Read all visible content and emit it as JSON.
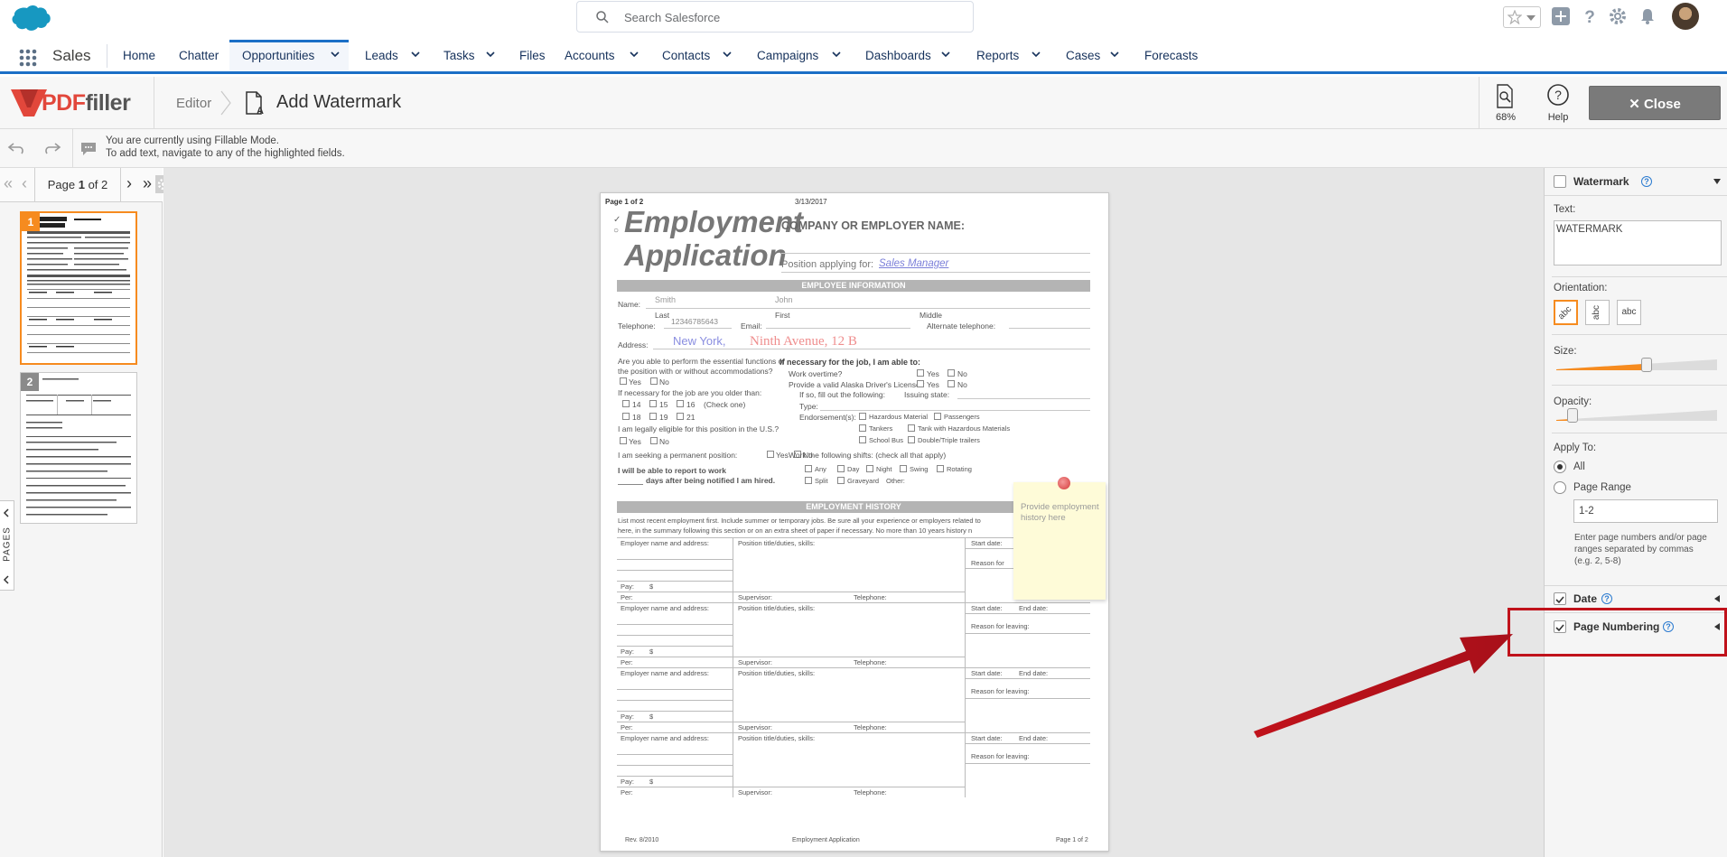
{
  "global_header": {
    "search_placeholder": "Search Salesforce"
  },
  "nav": {
    "app_name": "Sales",
    "items": [
      {
        "label": "Home"
      },
      {
        "label": "Chatter"
      },
      {
        "label": "Opportunities"
      },
      {
        "label": "Leads"
      },
      {
        "label": "Tasks"
      },
      {
        "label": "Files"
      },
      {
        "label": "Accounts"
      },
      {
        "label": "Contacts"
      },
      {
        "label": "Campaigns"
      },
      {
        "label": "Dashboards"
      },
      {
        "label": "Reports"
      },
      {
        "label": "Cases"
      },
      {
        "label": "Forecasts"
      }
    ],
    "active": "Opportunities"
  },
  "editor": {
    "logo_pdf": "PDF",
    "logo_filler": "filler",
    "breadcrumb_editor": "Editor",
    "title": "Add Watermark",
    "zoom": "68%",
    "help_label": "Help",
    "close_label": "Close"
  },
  "info": {
    "line1": "You are currently using Fillable Mode.",
    "line2": "To add text, navigate to any of the highlighted fields."
  },
  "pages_panel": {
    "page_prefix": "Page",
    "current_page": "1",
    "of_label": "of 2",
    "thumb1_num": "1",
    "thumb2_num": "2",
    "tab_label": "PAGES"
  },
  "document": {
    "page_header": "Page 1 of 2",
    "date": "3/13/2017",
    "title_line1": "Employment",
    "title_line2": "Application",
    "company_label": "COMPANY OR EMPLOYER NAME:",
    "position_label": "Position applying for:",
    "position_value": "Sales Manager",
    "section_employee": "EMPLOYEE INFORMATION",
    "name_label": "Name:",
    "last_name_value": "Smith",
    "first_name_value": "John",
    "last_label": "Last",
    "first_label": "First",
    "middle_label": "Middle",
    "telephone_label": "Telephone:",
    "telephone_value": "12346785643",
    "email_label": "Email:",
    "alt_phone_label": "Alternate telephone:",
    "address_label": "Address:",
    "address_city": "New York,",
    "address_street": "Ninth Avenue, 12 B",
    "q_essential": "Are you able to perform the essential functions of",
    "q_essential2": "the position with or without accommodations?",
    "q_necessary": "If necessary for the job, I am able to:",
    "work_overtime": "Work overtime?",
    "valid_license": "Provide a valid Alaska Driver's License?",
    "if_so": "If so, fill out the following:",
    "issuing_state": "Issuing state:",
    "type_label": "Type:",
    "endorsements": "Endorsement(s):",
    "hazardous": "Hazardous Material",
    "passengers": "Passengers",
    "tankers": "Tankers",
    "tank_haz": "Tank with Hazardous Materials",
    "school_bus": "School Bus",
    "double_triple": "Double/Triple trailers",
    "older_than": "If necessary for the job are you older than:",
    "check_one": "(Check one)",
    "age_14": "14",
    "age_15": "15",
    "age_16": "16",
    "age_18": "18",
    "age_19": "19",
    "age_21": "21",
    "eligible": "I am legally eligible for this position in the U.S.?",
    "yes": "Yes",
    "no": "No",
    "permanent": "I am seeking a permanent position:",
    "shifts": "Work the following shifts: (check all that apply)",
    "report1": "I will be able to report to work",
    "report2": "days after being notified I am hired.",
    "any": "Any",
    "day": "Day",
    "night": "Night",
    "swing": "Swing",
    "rotating": "Rotating",
    "split": "Split",
    "graveyard": "Graveyard",
    "other": "Other:",
    "section_history": "EMPLOYMENT HISTORY",
    "history_intro1": "List most recent employment first. Include summer or temporary jobs. Be sure all your experience or employers related to",
    "history_intro2": "here, in the summary following this section or on an extra sheet of paper if necessary. No more than 10 years history n",
    "employer_label": "Employer name and address:",
    "position_duties": "Position title/duties, skills:",
    "start_date": "Start date:",
    "end_date": "End date:",
    "reason_leaving": "Reason for leaving:",
    "reason_for": "Reason for",
    "pay_label": "Pay:",
    "dollar": "$",
    "per_label": "Per:",
    "supervisor": "Supervisor:",
    "telephone": "Telephone:",
    "footer_rev": "Rev. 8/2010",
    "footer_title": "Employment Application",
    "footer_page": "Page 1 of 2"
  },
  "sticky_note": {
    "text": "Provide employment history here"
  },
  "right_panel": {
    "watermark_title": "Watermark",
    "text_label": "Text:",
    "text_value": "WATERMARK",
    "orientation_label": "Orientation:",
    "orient_btn": "abc",
    "size_label": "Size:",
    "size_level": 0.56,
    "opacity_label": "Opacity:",
    "opacity_level": 0.1,
    "apply_to_label": "Apply To:",
    "all_label": "All",
    "range_label": "Page Range",
    "range_value": "1-2",
    "range_help": "Enter page numbers and/or page ranges separated by commas (e.g. 2, 5-8)",
    "date_title": "Date",
    "page_numbering_title": "Page Numbering",
    "help_glyph": "?"
  },
  "colors": {
    "accent": "#1b6fc6",
    "pdffiller_red": "#e2473b",
    "selection_orange": "#f68b1f",
    "annotation_red": "#c0121b",
    "slider_orange": "#f68b1f"
  }
}
